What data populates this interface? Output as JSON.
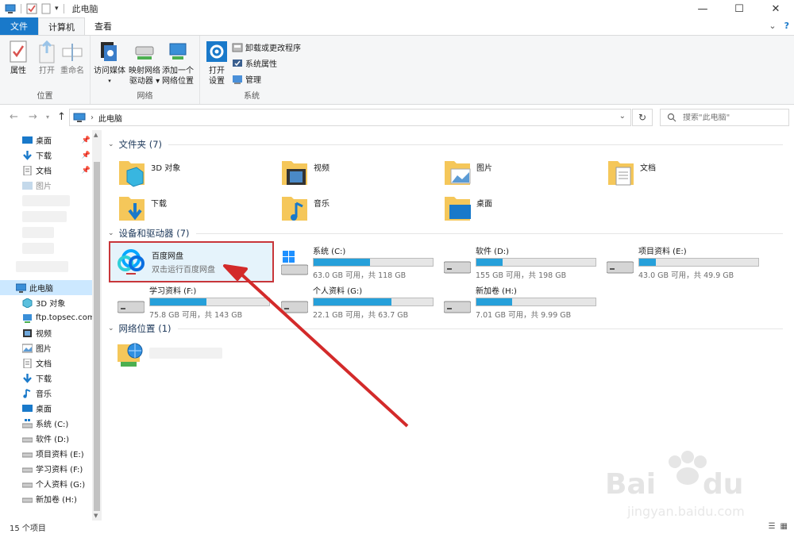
{
  "window": {
    "title": "此电脑",
    "controls": {
      "minimize": "—",
      "maximize": "☐",
      "close": "✕"
    }
  },
  "ribbon_tabs": [
    {
      "label": "文件"
    },
    {
      "label": "计算机"
    },
    {
      "label": "查看"
    }
  ],
  "ribbon_right": {
    "expand": "⌄",
    "help": "?"
  },
  "ribbon": {
    "location_group": {
      "label": "位置",
      "properties": "属性",
      "open": "打开",
      "rename": "重命名"
    },
    "network_group": {
      "label": "网络",
      "access_media": "访问媒体",
      "map_drive_line1": "映射网络",
      "map_drive_line2": "驱动器",
      "add_location_line1": "添加一个",
      "add_location_line2": "网络位置"
    },
    "system_group": {
      "label": "系统",
      "open_settings_line1": "打开",
      "open_settings_line2": "设置",
      "uninstall": "卸载或更改程序",
      "system_properties": "系统属性",
      "manage": "管理"
    }
  },
  "address": {
    "path": "此电脑",
    "search_placeholder": "搜索\"此电脑\""
  },
  "nav_pane": {
    "quick_access": [
      {
        "label": "桌面"
      },
      {
        "label": "下载"
      },
      {
        "label": "文档"
      },
      {
        "label": "图片"
      }
    ],
    "this_pc": "此电脑",
    "pc_children": [
      {
        "label": "3D 对象"
      },
      {
        "label": "ftp.topsec.com"
      },
      {
        "label": "视频"
      },
      {
        "label": "图片"
      },
      {
        "label": "文档"
      },
      {
        "label": "下载"
      },
      {
        "label": "音乐"
      },
      {
        "label": "桌面"
      },
      {
        "label": "系统 (C:)"
      },
      {
        "label": "软件 (D:)"
      },
      {
        "label": "项目资料 (E:)"
      },
      {
        "label": "学习资料 (F:)"
      },
      {
        "label": "个人资料 (G:)"
      },
      {
        "label": "新加卷 (H:)"
      }
    ]
  },
  "sections": {
    "folders": "文件夹 (7)",
    "devices": "设备和驱动器 (7)",
    "network": "网络位置 (1)"
  },
  "folders": [
    {
      "name": "3D 对象"
    },
    {
      "name": "视频"
    },
    {
      "name": "图片"
    },
    {
      "name": "文档"
    },
    {
      "name": "下载"
    },
    {
      "name": "音乐"
    },
    {
      "name": "桌面"
    }
  ],
  "baidu": {
    "name": "百度网盘",
    "desc": "双击运行百度网盘"
  },
  "drives": [
    {
      "name": "系统 (C:)",
      "free": "63.0 GB 可用，共 118 GB",
      "used": 0.47
    },
    {
      "name": "软件 (D:)",
      "free": "155 GB 可用，共 198 GB",
      "used": 0.22
    },
    {
      "name": "项目资料 (E:)",
      "free": "43.0 GB 可用，共 49.9 GB",
      "used": 0.14
    },
    {
      "name": "学习资料 (F:)",
      "free": "75.8 GB 可用，共 143 GB",
      "used": 0.47
    },
    {
      "name": "个人资料 (G:)",
      "free": "22.1 GB 可用，共 63.7 GB",
      "used": 0.65
    },
    {
      "name": "新加卷 (H:)",
      "free": "7.01 GB 可用，共 9.99 GB",
      "used": 0.3
    }
  ],
  "status": {
    "count": "15 个项目"
  },
  "colors": {
    "accent": "#1979ca",
    "drive_fill": "#26a0da",
    "highlight_border": "#c8363a",
    "arrow": "#d32a2a"
  }
}
